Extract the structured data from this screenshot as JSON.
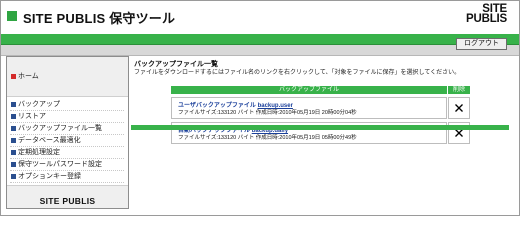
{
  "header": {
    "app_title": "SITE PUBLIS 保守ツール",
    "brand_line1": "SITE",
    "brand_line2": "PUBLIS",
    "logout_label": "ログアウト"
  },
  "sidebar": {
    "home_label": "ホーム",
    "items": [
      {
        "label": "バックアップ"
      },
      {
        "label": "リストア"
      },
      {
        "label": "バックアップファイル一覧"
      },
      {
        "label": "データベース最適化"
      },
      {
        "label": "定期処理設定"
      },
      {
        "label": "保守ツールパスワード設定"
      },
      {
        "label": "オプションキー登録"
      }
    ],
    "brand": "SITE PUBLIS"
  },
  "main": {
    "title": "バックアップファイル一覧",
    "description": "ファイルをダウンロードするにはファイル名のリンクを右クリックして、「対象をファイルに保存」を選択してください。",
    "table": {
      "col_file": "バックアップファイル",
      "col_delete": "削除",
      "rows": [
        {
          "type_label": "ユーザバックアップファイル",
          "filename": "backup.user",
          "info": "ファイルサイズ:133120 バイト 作成日時:2010年05月19日 20時00分04秒"
        },
        {
          "type_label": "自動バックアップファイル",
          "filename": "backup.daily",
          "info": "ファイルサイズ:133120 バイト 作成日時:2010年05月19日 05時00分49秒"
        }
      ]
    }
  },
  "colors": {
    "accent_green": "#38b24a",
    "link_blue": "#1a3f9a",
    "home_marker": "#d42b2b",
    "nav_marker": "#2b4f8f"
  }
}
